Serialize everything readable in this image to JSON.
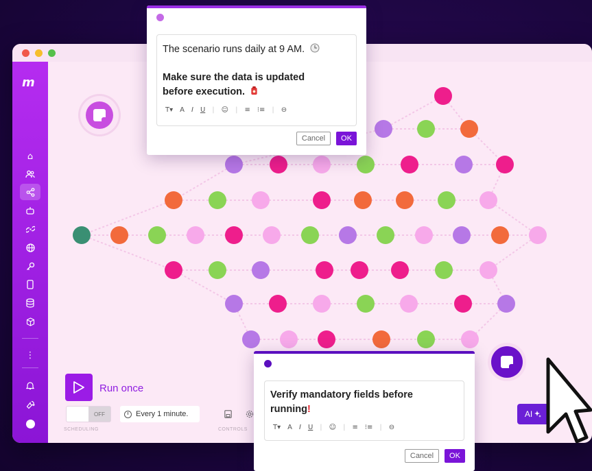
{
  "window": {
    "controls": [
      "close",
      "minimize",
      "maximize"
    ]
  },
  "sidebar": {
    "logo": "m",
    "items": [
      {
        "icon": "home-icon",
        "glyph": "⌂"
      },
      {
        "icon": "team-icon",
        "glyph": "👥"
      },
      {
        "icon": "share-icon",
        "glyph": "⟨"
      },
      {
        "icon": "bot-icon",
        "glyph": "⛭"
      },
      {
        "icon": "link-icon",
        "glyph": "∞"
      },
      {
        "icon": "globe-icon",
        "glyph": "◍"
      },
      {
        "icon": "key-icon",
        "glyph": "⚷"
      },
      {
        "icon": "device-icon",
        "glyph": "▯"
      },
      {
        "icon": "database-icon",
        "glyph": "☰"
      },
      {
        "icon": "cube-icon",
        "glyph": "⬡"
      },
      {
        "icon": "more-icon",
        "glyph": "⋮"
      },
      {
        "icon": "bell-icon",
        "glyph": "🔔"
      },
      {
        "icon": "wrench-icon",
        "glyph": "🔧"
      },
      {
        "icon": "avatar-icon",
        "glyph": "●"
      }
    ]
  },
  "note_top": {
    "line1": "The scenario runs daily at 9 AM.",
    "line2a": "Make sure the data is updated",
    "line2b": "before execution.",
    "cancel_label": "Cancel",
    "ok_label": "OK"
  },
  "note_bottom": {
    "line1a": "Verify mandatory fields before",
    "line1b": "running",
    "exclaim": "!",
    "cancel_label": "Cancel",
    "ok_label": "OK"
  },
  "toolbar": {
    "items": [
      "T▾",
      "A",
      "I",
      "U",
      "|",
      "☺",
      "|",
      "≡",
      "⋮≡",
      "|",
      "⊖"
    ]
  },
  "controls": {
    "run_label": "Run once",
    "toggle_label": "OFF",
    "schedule_text": "Every 1 minute.",
    "scheduling_label": "SCHEDULING",
    "controls_label": "CONTROLS",
    "ai_label": "AI"
  },
  "colors": {
    "accent": "#9b1ce6",
    "node_pink": "#ee1e8c",
    "node_green": "#8ad455",
    "node_orange": "#f26a3c",
    "node_purple": "#b678e6",
    "node_light": "#f7a9ea",
    "node_teal": "#3a8f73"
  }
}
